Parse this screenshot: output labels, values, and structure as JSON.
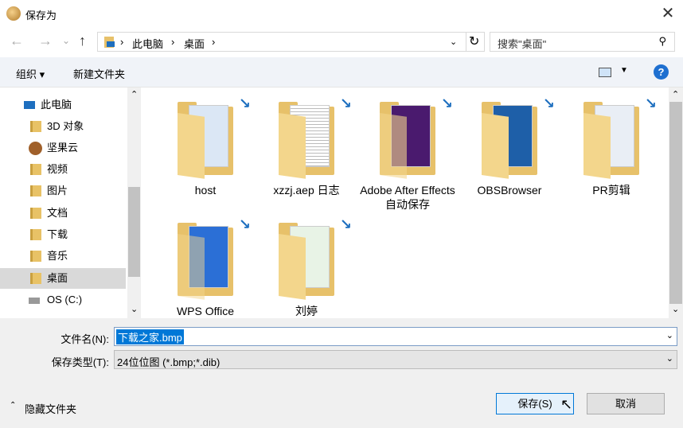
{
  "window": {
    "title": "保存为"
  },
  "nav": {
    "back": "←",
    "forward": "→",
    "recent": "⌄",
    "up": "↑"
  },
  "address": {
    "crumbs": [
      "此电脑",
      "桌面"
    ],
    "sep": "›"
  },
  "search": {
    "placeholder": "搜索\"桌面\""
  },
  "toolbar": {
    "organize": "组织 ▾",
    "new_folder": "新建文件夹",
    "help": "?"
  },
  "sidebar": {
    "items": [
      {
        "label": "此电脑"
      },
      {
        "label": "3D 对象"
      },
      {
        "label": "坚果云"
      },
      {
        "label": "视频"
      },
      {
        "label": "图片"
      },
      {
        "label": "文档"
      },
      {
        "label": "下载"
      },
      {
        "label": "音乐"
      },
      {
        "label": "桌面",
        "selected": true
      },
      {
        "label": "OS (C:)"
      }
    ]
  },
  "files": [
    {
      "name": "host"
    },
    {
      "name": "xzzj.aep 日志"
    },
    {
      "name": "Adobe After Effects 自动保存"
    },
    {
      "name": "OBSBrowser"
    },
    {
      "name": "PR剪辑"
    },
    {
      "name": "WPS Office"
    },
    {
      "name": "刘婷"
    }
  ],
  "form": {
    "filename_label": "文件名(N):",
    "filename_value": "下载之家.bmp",
    "type_label": "保存类型(T):",
    "type_value": "24位位图 (*.bmp;*.dib)"
  },
  "footer": {
    "hide_folders": "隐藏文件夹",
    "save": "保存(S)",
    "cancel": "取消"
  },
  "colors": {
    "accent": "#0078d7",
    "selected_bg": "#cce8ff"
  }
}
